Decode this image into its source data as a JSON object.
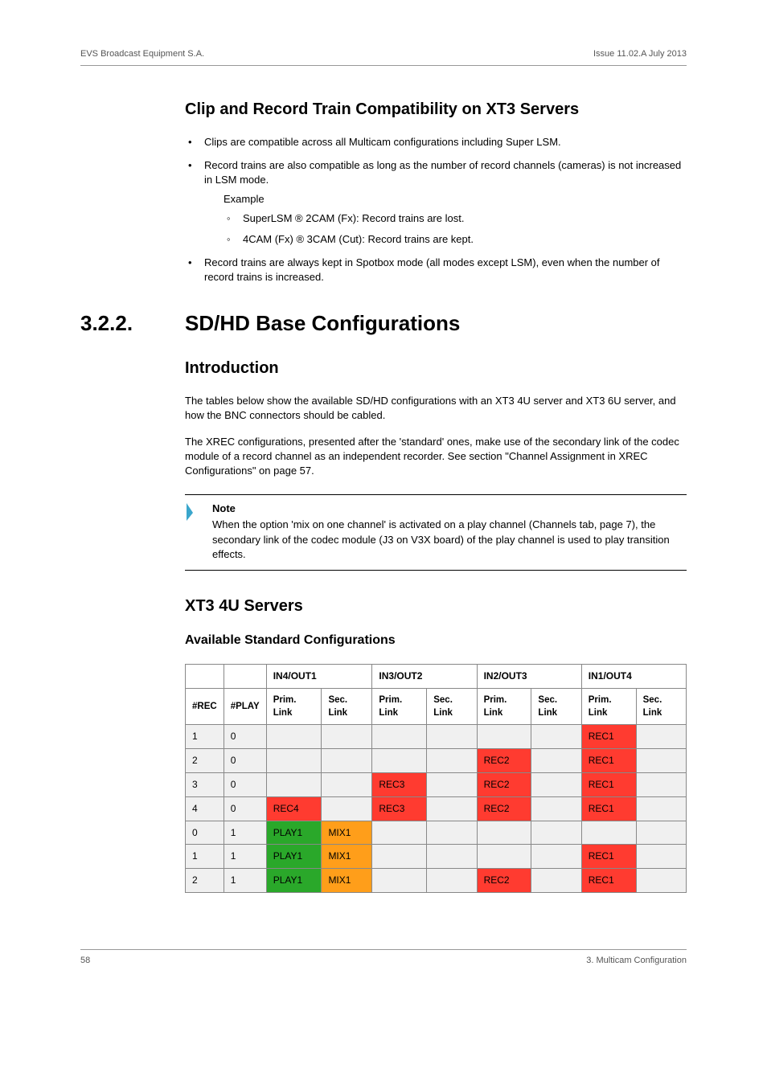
{
  "header": {
    "left": "EVS Broadcast Equipment S.A.",
    "right": "Issue 11.02.A  July 2013"
  },
  "h_clip": "Clip and Record Train Compatibility on XT3 Servers",
  "b1": "Clips are compatible across all Multicam configurations including Super LSM.",
  "b2": "Record trains are also compatible as long as the number of record channels (cameras) is not increased in LSM mode.",
  "b2_ex": "Example",
  "b2_c1": "SuperLSM ® 2CAM (Fx): Record trains are lost.",
  "b2_c2": "4CAM (Fx) ® 3CAM (Cut): Record trains are kept.",
  "b3": "Record trains are always kept in Spotbox mode (all modes except LSM), even when the number of record trains is increased.",
  "sec_num": "3.2.2.",
  "sec_title": "SD/HD Base Configurations",
  "h_intro": "Introduction",
  "intro_p1": "The tables below show the available SD/HD configurations with an XT3 4U server and XT3 6U server, and how the BNC connectors should be cabled.",
  "intro_p2": "The XREC configurations, presented after the 'standard' ones, make use of the secondary link of the codec module of a record channel as an independent recorder. See section \"Channel Assignment in XREC Configurations\" on page 57.",
  "note_title": "Note",
  "note_body": "When the option 'mix on one channel' is activated on a play channel (Channels tab, page 7), the secondary link of the codec module (J3 on V3X board) of the play channel is used to play transition effects.",
  "h_xt3": "XT3 4U Servers",
  "h_avail": "Available Standard Configurations",
  "th": {
    "io1": "IN4/OUT1",
    "io2": "IN3/OUT2",
    "io3": "IN2/OUT3",
    "io4": "IN1/OUT4",
    "rec": "#REC",
    "play": "#PLAY",
    "prim": "Prim. Link",
    "sec": "Sec. Link"
  },
  "rows": [
    {
      "rec": "1",
      "play": "0",
      "cells": [
        "",
        "",
        "",
        "",
        "",
        "",
        "REC1",
        ""
      ],
      "colors": [
        "",
        "",
        "",
        "",
        "",
        "",
        "red",
        ""
      ]
    },
    {
      "rec": "2",
      "play": "0",
      "cells": [
        "",
        "",
        "",
        "",
        "REC2",
        "",
        "REC1",
        ""
      ],
      "colors": [
        "",
        "",
        "",
        "",
        "red",
        "",
        "red",
        ""
      ]
    },
    {
      "rec": "3",
      "play": "0",
      "cells": [
        "",
        "",
        "REC3",
        "",
        "REC2",
        "",
        "REC1",
        ""
      ],
      "colors": [
        "",
        "",
        "red",
        "",
        "red",
        "",
        "red",
        ""
      ]
    },
    {
      "rec": "4",
      "play": "0",
      "cells": [
        "REC4",
        "",
        "REC3",
        "",
        "REC2",
        "",
        "REC1",
        ""
      ],
      "colors": [
        "red",
        "",
        "red",
        "",
        "red",
        "",
        "red",
        ""
      ]
    },
    {
      "rec": "0",
      "play": "1",
      "cells": [
        "PLAY1",
        "MIX1",
        "",
        "",
        "",
        "",
        "",
        ""
      ],
      "colors": [
        "green",
        "orange",
        "",
        "",
        "",
        "",
        "",
        ""
      ]
    },
    {
      "rec": "1",
      "play": "1",
      "cells": [
        "PLAY1",
        "MIX1",
        "",
        "",
        "",
        "",
        "REC1",
        ""
      ],
      "colors": [
        "green",
        "orange",
        "",
        "",
        "",
        "",
        "red",
        ""
      ]
    },
    {
      "rec": "2",
      "play": "1",
      "cells": [
        "PLAY1",
        "MIX1",
        "",
        "",
        "REC2",
        "",
        "REC1",
        ""
      ],
      "colors": [
        "green",
        "orange",
        "",
        "",
        "red",
        "",
        "red",
        ""
      ]
    }
  ],
  "footer": {
    "left": "58",
    "right": "3. Multicam Configuration"
  }
}
